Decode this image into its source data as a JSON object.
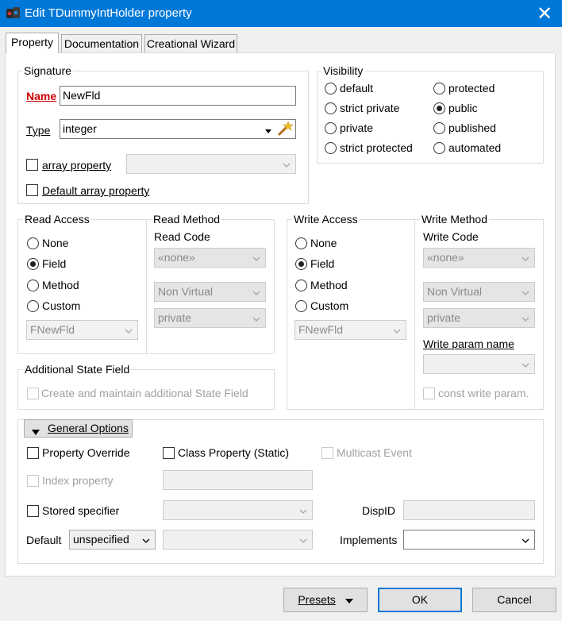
{
  "window": {
    "title": "Edit TDummyIntHolder property",
    "app_icon": "app-logo-icon",
    "close_glyph": "✕"
  },
  "tabs": [
    {
      "label": "Property",
      "active": true
    },
    {
      "label": "Documentation",
      "active": false
    },
    {
      "label": "Creational Wizard",
      "active": false
    }
  ],
  "signature": {
    "group_label": "Signature",
    "name_label": "Name",
    "name_value": "NewFld",
    "type_label": "Type",
    "type_value": "integer",
    "type_picker_icon": "magic-wand-icon",
    "array_property_label": "array property",
    "array_property_checked": false,
    "default_array_label": "Default array property",
    "default_array_checked": false
  },
  "visibility": {
    "group_label": "Visibility",
    "options": [
      {
        "label": "default",
        "selected": false
      },
      {
        "label": "strict private",
        "selected": false
      },
      {
        "label": "private",
        "selected": false
      },
      {
        "label": "strict protected",
        "selected": false
      },
      {
        "label": "protected",
        "selected": false
      },
      {
        "label": "public",
        "selected": true
      },
      {
        "label": "published",
        "selected": false
      },
      {
        "label": "automated",
        "selected": false
      }
    ]
  },
  "read_access": {
    "group_label": "Read Access",
    "options": [
      {
        "label": "None",
        "selected": false
      },
      {
        "label": "Field",
        "selected": true
      },
      {
        "label": "Method",
        "selected": false
      },
      {
        "label": "Custom",
        "selected": false
      }
    ],
    "field_value": "FNewFld"
  },
  "read_method": {
    "group_label": "Read Method",
    "code_label": "Read Code",
    "code_value": "«none»",
    "virtual_value": "Non Virtual",
    "visibility_value": "private"
  },
  "write_access": {
    "group_label": "Write Access",
    "options": [
      {
        "label": "None",
        "selected": false
      },
      {
        "label": "Field",
        "selected": true
      },
      {
        "label": "Method",
        "selected": false
      },
      {
        "label": "Custom",
        "selected": false
      }
    ],
    "field_value": "FNewFld"
  },
  "write_method": {
    "group_label": "Write Method",
    "code_label": "Write Code",
    "code_value": "«none»",
    "virtual_value": "Non Virtual",
    "visibility_value": "private",
    "param_name_label": "Write param name",
    "param_name_value": "",
    "const_param_label": "const write param.",
    "const_param_checked": false
  },
  "state_field": {
    "group_label": "Additional State Field",
    "create_label": "Create and maintain additional State Field",
    "create_checked": false
  },
  "general_options": {
    "toggle_label": "General Options",
    "property_override_label": "Property Override",
    "property_override_checked": false,
    "class_property_label": "Class Property (Static)",
    "class_property_checked": false,
    "multicast_label": "Multicast Event",
    "multicast_checked": false,
    "index_property_label": "Index property",
    "index_property_checked": false,
    "index_value": "",
    "stored_label": "Stored specifier",
    "stored_checked": false,
    "stored_value": "",
    "dispid_label": "DispID",
    "dispid_value": "",
    "default_label": "Default",
    "default_value": "unspecified",
    "default_extra_value": "",
    "implements_label": "Implements",
    "implements_value": ""
  },
  "buttons": {
    "presets": "Presets",
    "ok": "OK",
    "cancel": "Cancel"
  }
}
